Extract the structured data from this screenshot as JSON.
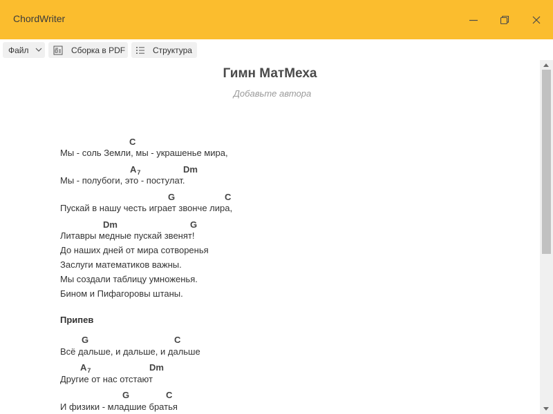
{
  "app": {
    "title": "ChordWriter"
  },
  "window_controls": {
    "minimize": "minimize",
    "maximize": "maximize",
    "close": "close"
  },
  "toolbar": {
    "file_label": "Файл",
    "pdf_label": "Сборка в PDF",
    "structure_label": "Структура"
  },
  "song": {
    "title": "Гимн МатМеха",
    "author_placeholder": "Добавьте автора",
    "verse": [
      {
        "text": "Мы - соль Земли, мы - украшенье мира,",
        "chords": [
          {
            "name": "C",
            "sub": ""
          }
        ]
      },
      {
        "text": "Мы - полубоги, это - постулат.",
        "chords": [
          {
            "name": "A",
            "sub": "7"
          },
          {
            "name": "Dm",
            "sub": ""
          }
        ]
      },
      {
        "text": "Пускай в нашу честь играет звонче лира,",
        "chords": [
          {
            "name": "G",
            "sub": ""
          },
          {
            "name": "C",
            "sub": ""
          }
        ]
      },
      {
        "text": "Литавры медные пускай звенят!",
        "chords": [
          {
            "name": "Dm",
            "sub": ""
          },
          {
            "name": "G",
            "sub": ""
          }
        ]
      },
      {
        "text": "До наших дней от мира сотворенья",
        "chords": []
      },
      {
        "text": "Заслуги математиков важны.",
        "chords": []
      },
      {
        "text": "Мы создали таблицу умноженья.",
        "chords": []
      },
      {
        "text": "Бином и Пифагоровы штаны.",
        "chords": []
      }
    ],
    "chorus_label": "Припев",
    "chorus": [
      {
        "text": "Всё дальше, и дальше, и дальше",
        "chords": [
          {
            "name": "G",
            "sub": ""
          },
          {
            "name": "C",
            "sub": ""
          }
        ]
      },
      {
        "text": "Другие от нас отстают",
        "chords": [
          {
            "name": "A",
            "sub": "7"
          },
          {
            "name": "Dm",
            "sub": ""
          }
        ]
      },
      {
        "text": "И физики - младшие братья",
        "chords": [
          {
            "name": "G",
            "sub": ""
          },
          {
            "name": "C",
            "sub": ""
          }
        ]
      }
    ]
  }
}
